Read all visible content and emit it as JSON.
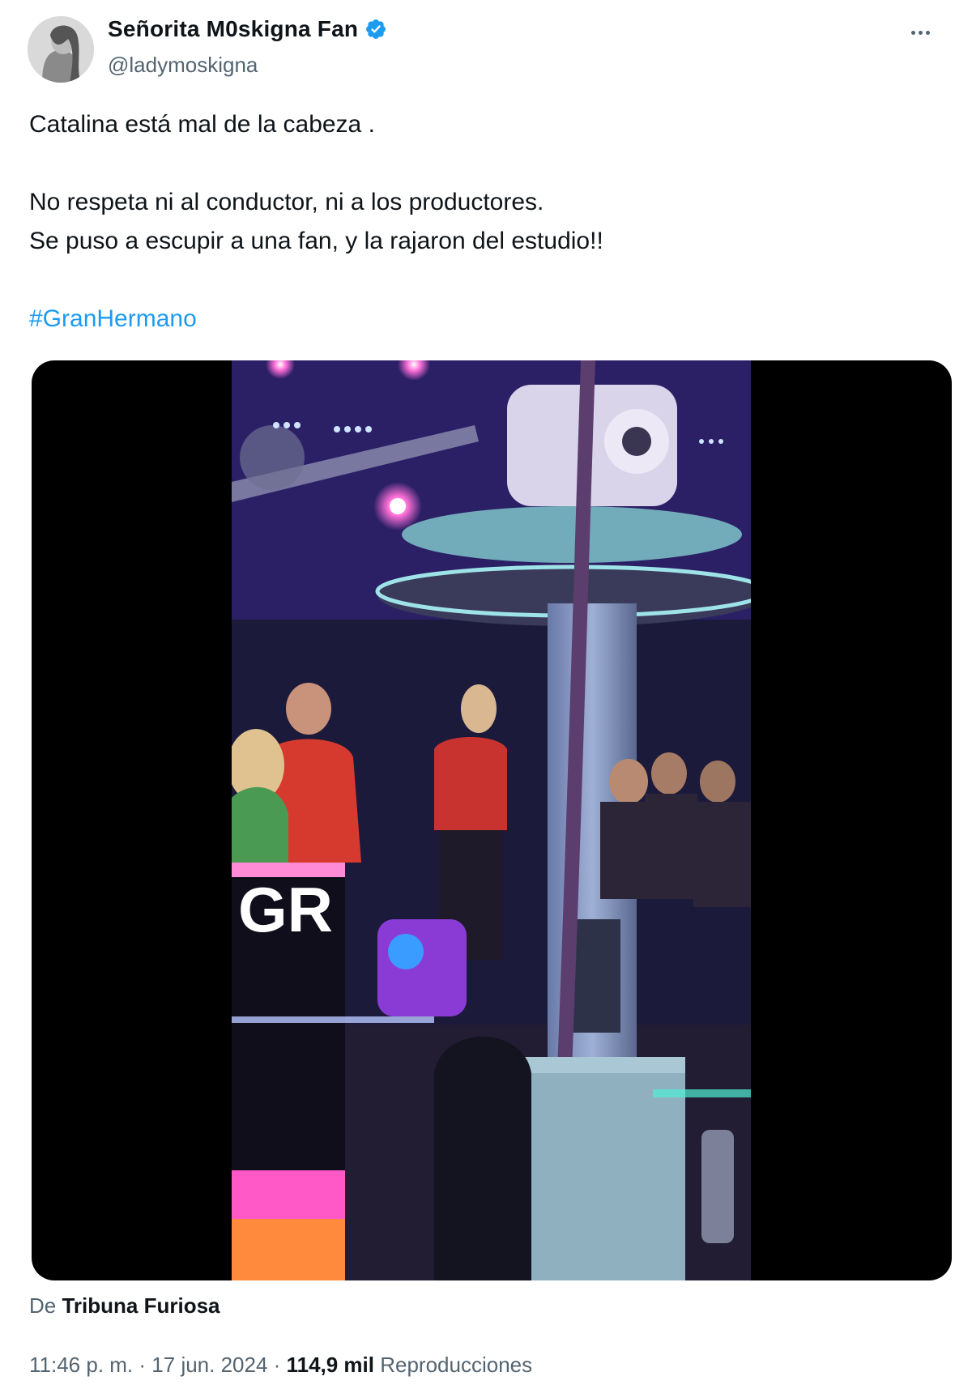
{
  "author": {
    "display_name": "Señorita M0skigna Fan",
    "handle": "@ladymoskigna",
    "verified": true
  },
  "tweet": {
    "lines": [
      "Catalina está mal de la cabeza .",
      "No respeta ni al conductor, ni a los productores.",
      "Se puso a escupir a una fan, y la rajaron del estudio!!"
    ],
    "hashtag": "#GranHermano"
  },
  "media": {
    "screen_text": "GR"
  },
  "source": {
    "prefix": "De",
    "name": "Tribuna Furiosa"
  },
  "meta": {
    "time": "11:46 p. m.",
    "separator": "·",
    "date": "17 jun. 2024",
    "views_count": "114,9 mil",
    "views_label": "Reproducciones"
  },
  "colors": {
    "accent": "#1d9bf0",
    "secondary_text": "#536471",
    "primary_text": "#0f1419"
  },
  "icons": {
    "verified": "verified-badge-icon",
    "more": "more-options-icon"
  }
}
